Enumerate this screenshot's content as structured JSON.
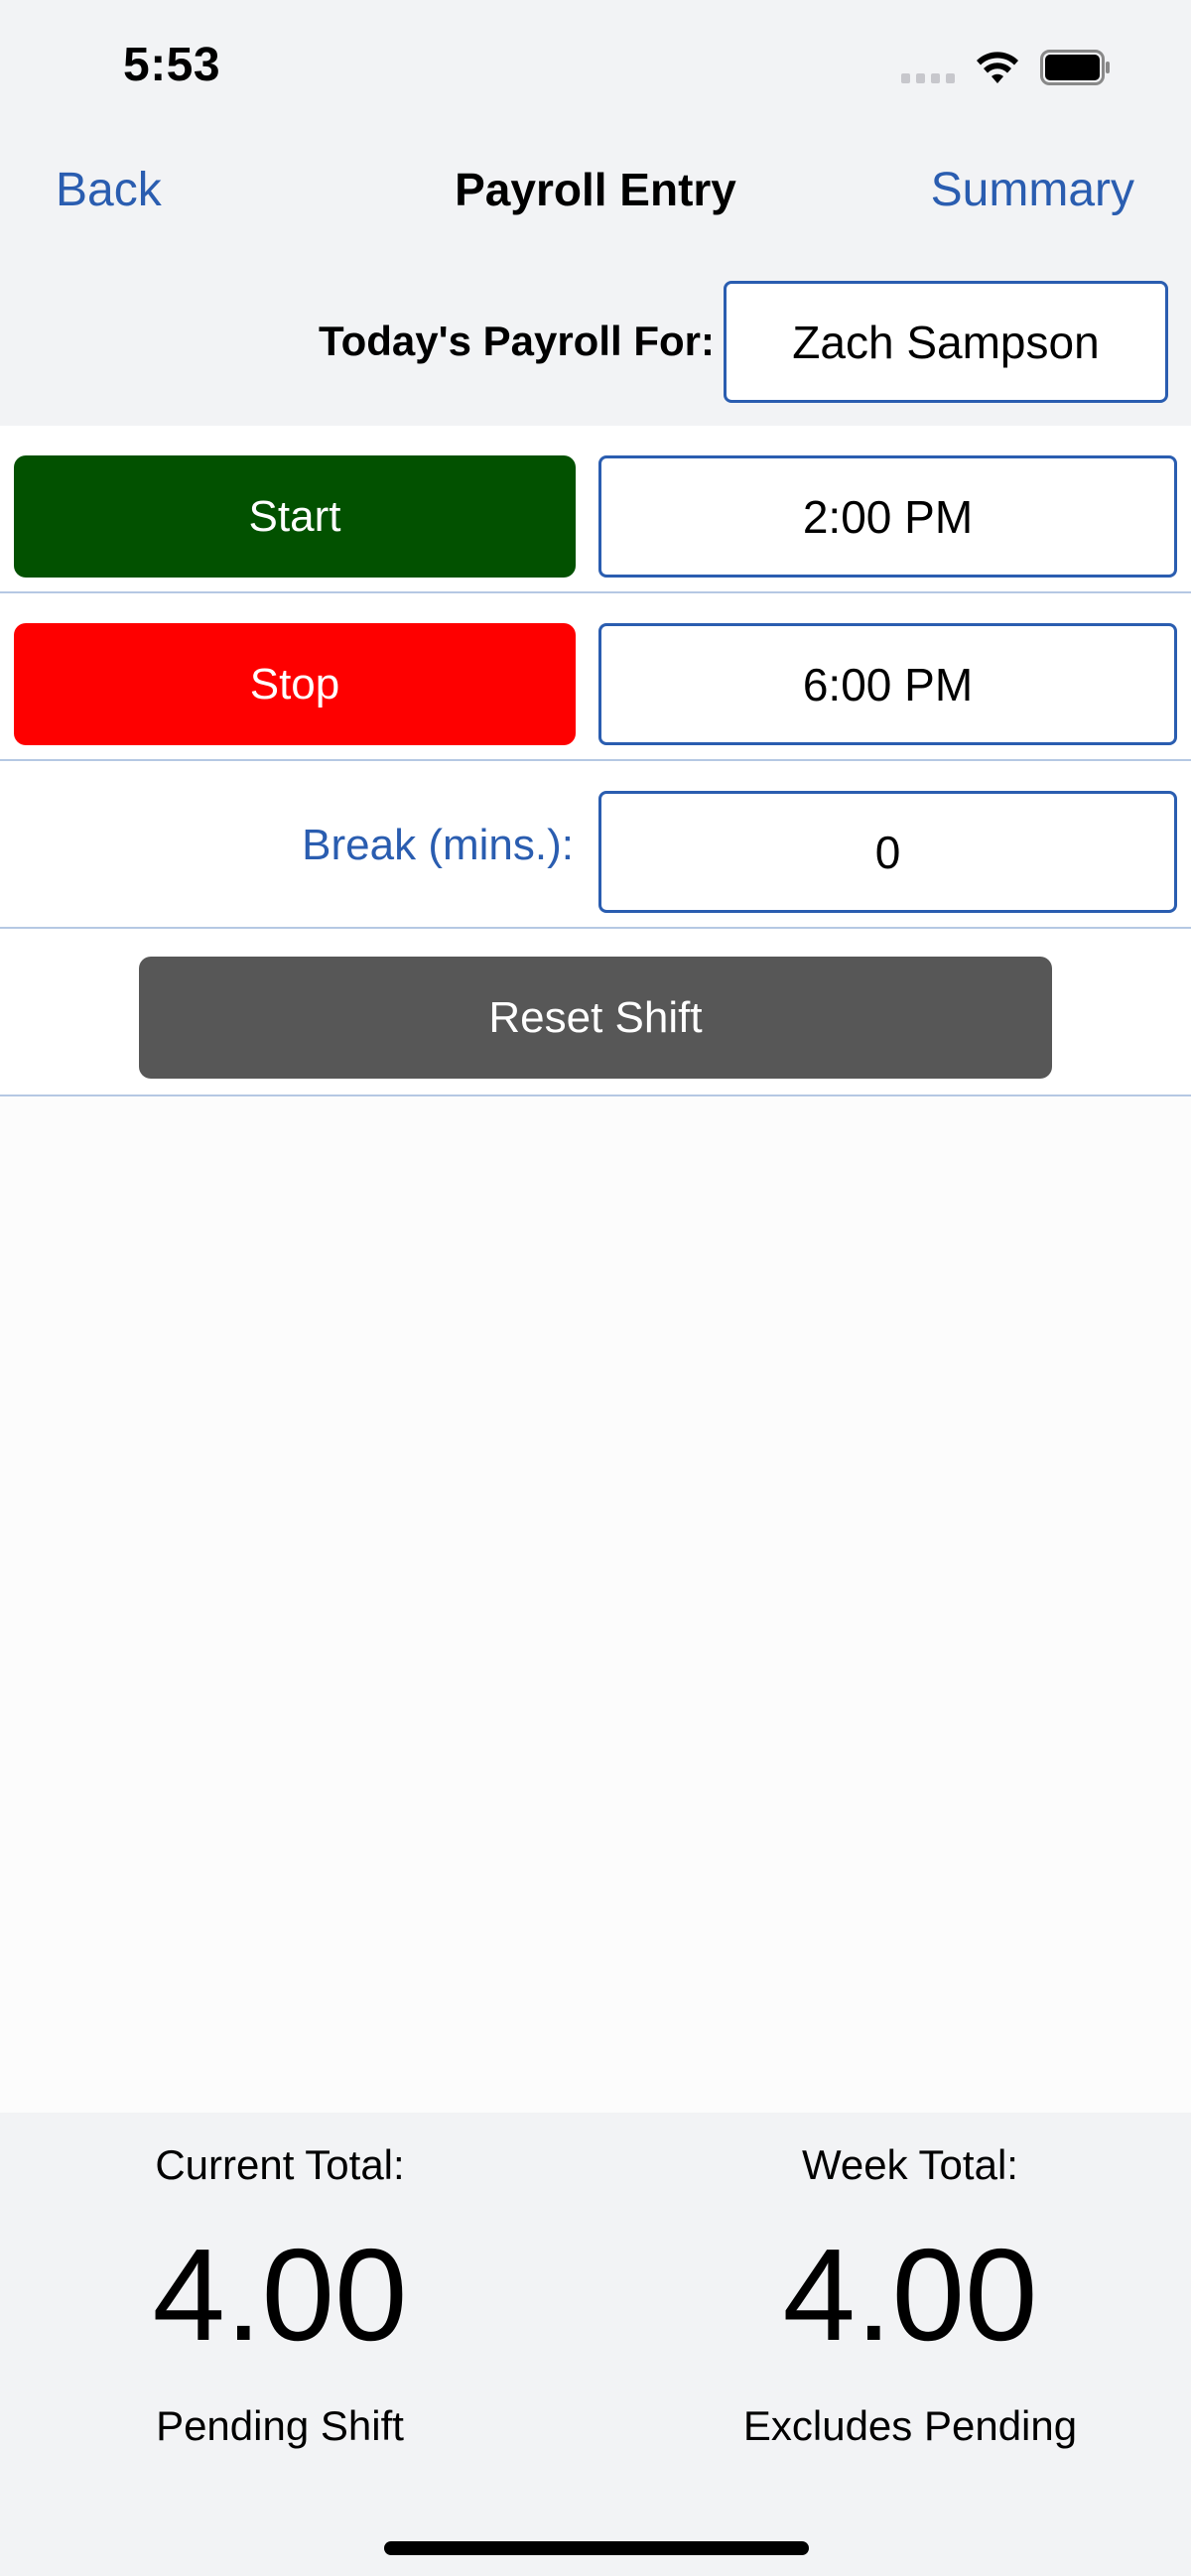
{
  "status_bar": {
    "time": "5:53"
  },
  "nav": {
    "back_label": "Back",
    "title": "Payroll Entry",
    "summary_label": "Summary"
  },
  "employee": {
    "label": "Today's Payroll For:",
    "name": "Zach Sampson"
  },
  "shift": {
    "start_label": "Start",
    "start_time": "2:00 PM",
    "stop_label": "Stop",
    "stop_time": "6:00 PM",
    "break_label": "Break (mins.):",
    "break_value": "0",
    "reset_label": "Reset Shift"
  },
  "totals": {
    "current": {
      "label": "Current Total:",
      "value": "4.00",
      "sub": "Pending Shift"
    },
    "week": {
      "label": "Week Total:",
      "value": "4.00",
      "sub": "Excludes Pending"
    }
  },
  "colors": {
    "accent": "#2a5db0",
    "start": "#025100",
    "stop": "#fe0000",
    "reset": "#575757"
  }
}
